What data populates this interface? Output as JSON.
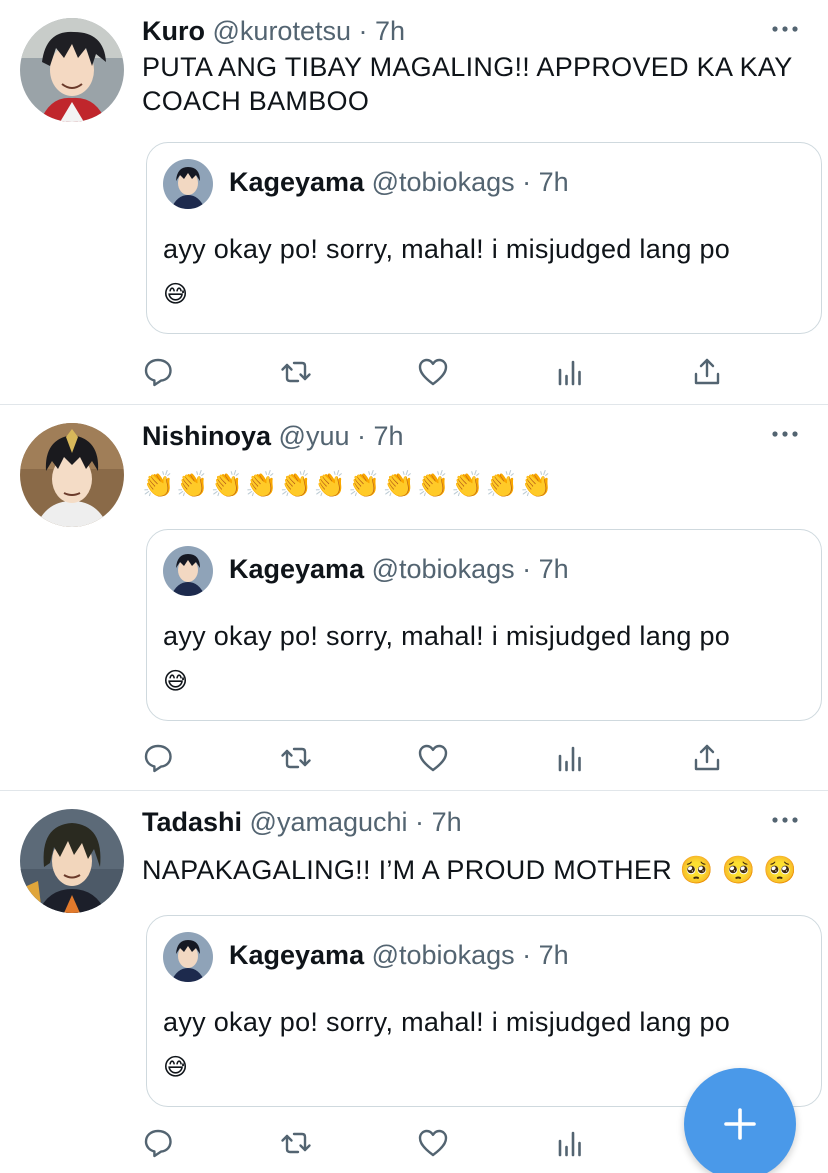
{
  "tweets": [
    {
      "name": "Kuro",
      "handle": "@kurotetsu",
      "dot": "·",
      "time": "7h",
      "text": "PUTA ANG TIBAY MAGALING!! APPROVED KA KAY COACH BAMBOO",
      "avatar_icon": "kuro-avatar",
      "quote": {
        "name": "Kageyama",
        "handle": "@tobiokags",
        "dot": "·",
        "time": "7h",
        "text": "ayy okay po! sorry, mahal! i misjudged lang po",
        "emoji": "😅"
      }
    },
    {
      "name": "Nishinoya",
      "handle": "@yuu",
      "dot": "·",
      "time": "7h",
      "text": "👏👏👏👏👏👏👏👏👏👏👏👏",
      "avatar_icon": "nishinoya-avatar",
      "quote": {
        "name": "Kageyama",
        "handle": "@tobiokags",
        "dot": "·",
        "time": "7h",
        "text": "ayy okay po! sorry, mahal! i misjudged lang po",
        "emoji": "😅"
      }
    },
    {
      "name": "Tadashi",
      "handle": "@yamaguchi",
      "dot": "·",
      "time": "7h",
      "text": "NAPAKAGALING!! I’M A PROUD MOTHER 🥺 🥺 🥺",
      "avatar_icon": "tadashi-avatar",
      "quote": {
        "name": "Kageyama",
        "handle": "@tobiokags",
        "dot": "·",
        "time": "7h",
        "text": "ayy okay po! sorry, mahal! i misjudged lang po",
        "emoji": "😅"
      }
    }
  ],
  "icons": {
    "reply": "reply-icon",
    "retweet": "retweet-icon",
    "like": "like-icon",
    "analytics": "analytics-icon",
    "share": "share-icon",
    "more": "more-icon",
    "compose": "compose-plus-icon"
  },
  "colors": {
    "text": "#0f1419",
    "secondary": "#536471",
    "icon": "#536471",
    "border": "#cfd9de",
    "divider": "#e1e6ea",
    "fab": "#4a99e9"
  }
}
